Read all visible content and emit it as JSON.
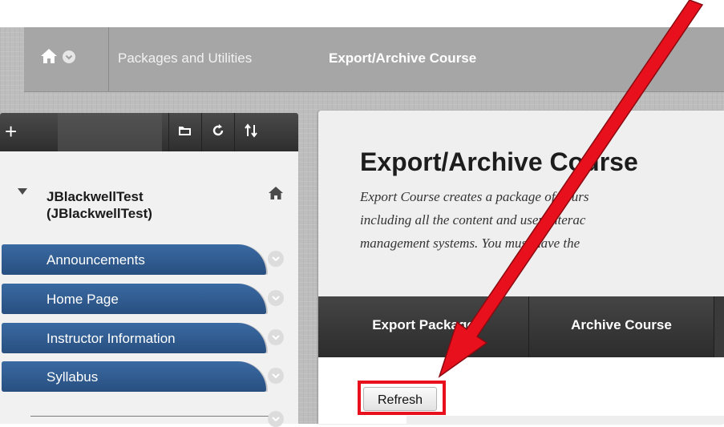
{
  "breadcrumb": {
    "home_icon": "home-icon",
    "menu_icon": "chevron-down-icon",
    "items": [
      "Packages and Utilities",
      "Export/Archive Course"
    ]
  },
  "toolbar": {
    "add_label": "+",
    "icons": [
      "folder-icon",
      "refresh-icon",
      "sort-icon"
    ]
  },
  "course": {
    "title": "JBlackwellTest (JBlackwellTest)",
    "home_icon": "home-icon"
  },
  "menu": {
    "items": [
      {
        "label": "Announcements"
      },
      {
        "label": "Home Page"
      },
      {
        "label": "Instructor Information"
      },
      {
        "label": "Syllabus"
      }
    ],
    "accent_color": "#2f5d94"
  },
  "content": {
    "title": "Export/Archive Course",
    "description_lines": [
      "Export Course creates a package of cours",
      "including all the content and user interac",
      "management systems. You must have the"
    ],
    "tabs": [
      {
        "label": "Export Package"
      },
      {
        "label": "Archive Course"
      }
    ],
    "refresh_button": "Refresh"
  },
  "annotation": {
    "color": "#e8101d",
    "highlight_target": "refresh-button"
  }
}
